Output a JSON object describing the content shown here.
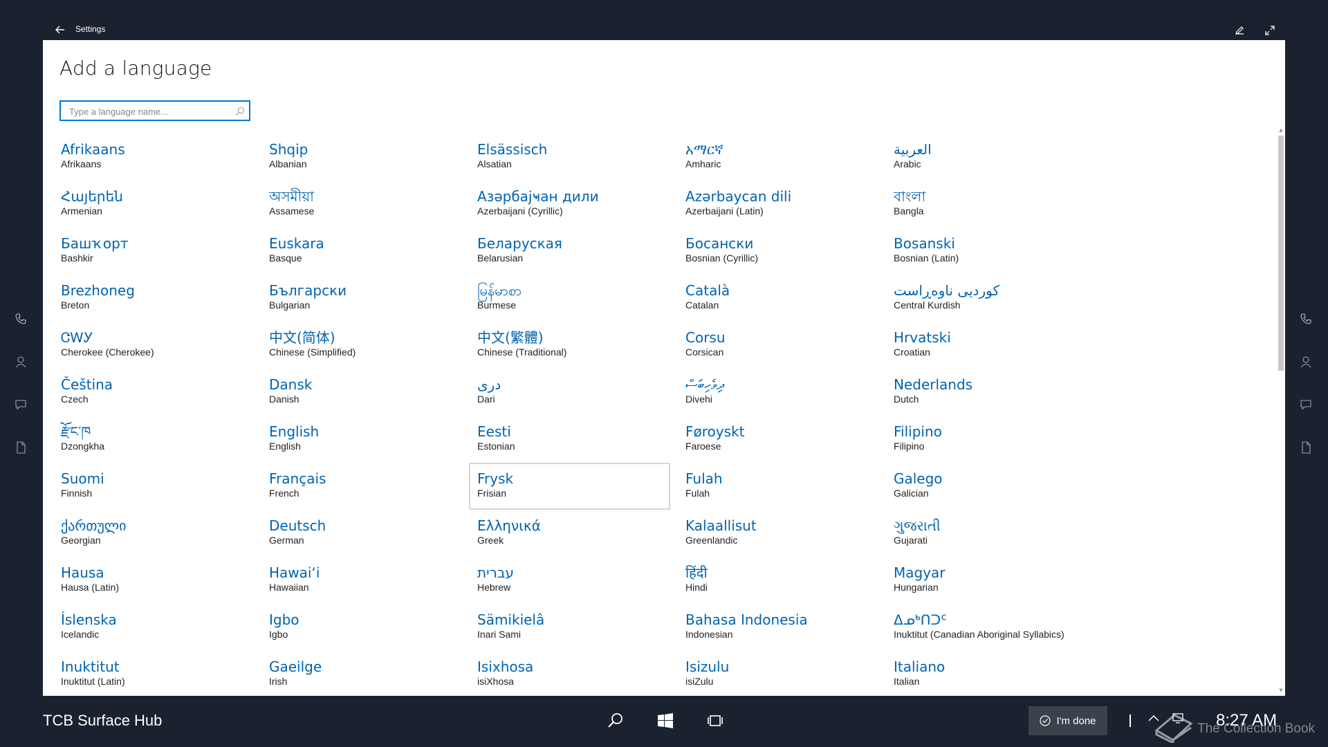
{
  "window": {
    "title": "Settings"
  },
  "page": {
    "title": "Add a language"
  },
  "search": {
    "placeholder": "Type a language name..."
  },
  "languages": [
    {
      "native": "Afrikaans",
      "english": "Afrikaans"
    },
    {
      "native": "Shqip",
      "english": "Albanian"
    },
    {
      "native": "Elsässisch",
      "english": "Alsatian"
    },
    {
      "native": "አማርኛ",
      "english": "Amharic"
    },
    {
      "native": "العربية",
      "english": "Arabic"
    },
    {
      "native": "Հայերեն",
      "english": "Armenian"
    },
    {
      "native": "অসমীয়া",
      "english": "Assamese"
    },
    {
      "native": "Азәрбајҹан дили",
      "english": "Azerbaijani (Cyrillic)"
    },
    {
      "native": "Azərbaycan dili",
      "english": "Azerbaijani (Latin)"
    },
    {
      "native": "বাংলা",
      "english": "Bangla"
    },
    {
      "native": "Башҡорт",
      "english": "Bashkir"
    },
    {
      "native": "Euskara",
      "english": "Basque"
    },
    {
      "native": "Беларуская",
      "english": "Belarusian"
    },
    {
      "native": "Босански",
      "english": "Bosnian (Cyrillic)"
    },
    {
      "native": "Bosanski",
      "english": "Bosnian (Latin)"
    },
    {
      "native": "Brezhoneg",
      "english": "Breton"
    },
    {
      "native": "Български",
      "english": "Bulgarian"
    },
    {
      "native": "မြန်မာစာ",
      "english": "Burmese"
    },
    {
      "native": "Català",
      "english": "Catalan"
    },
    {
      "native": "کوردیی ناوەڕاست",
      "english": "Central Kurdish"
    },
    {
      "native": "ᏣᎳᎩ",
      "english": "Cherokee (Cherokee)"
    },
    {
      "native": "中文(简体)",
      "english": "Chinese (Simplified)"
    },
    {
      "native": "中文(繁體)",
      "english": "Chinese (Traditional)"
    },
    {
      "native": "Corsu",
      "english": "Corsican"
    },
    {
      "native": "Hrvatski",
      "english": "Croatian"
    },
    {
      "native": "Čeština",
      "english": "Czech"
    },
    {
      "native": "Dansk",
      "english": "Danish"
    },
    {
      "native": "درى",
      "english": "Dari"
    },
    {
      "native": "ދިވެހިބަސް",
      "english": "Divehi"
    },
    {
      "native": "Nederlands",
      "english": "Dutch"
    },
    {
      "native": "རྫོང་ཁ",
      "english": "Dzongkha"
    },
    {
      "native": "English",
      "english": "English"
    },
    {
      "native": "Eesti",
      "english": "Estonian"
    },
    {
      "native": "Føroyskt",
      "english": "Faroese"
    },
    {
      "native": "Filipino",
      "english": "Filipino"
    },
    {
      "native": "Suomi",
      "english": "Finnish"
    },
    {
      "native": "Français",
      "english": "French"
    },
    {
      "native": "Frysk",
      "english": "Frisian",
      "selected": true
    },
    {
      "native": "Fulah",
      "english": "Fulah"
    },
    {
      "native": "Galego",
      "english": "Galician"
    },
    {
      "native": "ქართული",
      "english": "Georgian"
    },
    {
      "native": "Deutsch",
      "english": "German"
    },
    {
      "native": "Ελληνικά",
      "english": "Greek"
    },
    {
      "native": "Kalaallisut",
      "english": "Greenlandic"
    },
    {
      "native": "ગુજરાતી",
      "english": "Gujarati"
    },
    {
      "native": "Hausa",
      "english": "Hausa (Latin)"
    },
    {
      "native": "Hawaiʻi",
      "english": "Hawaiian"
    },
    {
      "native": "עברית",
      "english": "Hebrew"
    },
    {
      "native": "हिंदी",
      "english": "Hindi"
    },
    {
      "native": "Magyar",
      "english": "Hungarian"
    },
    {
      "native": "Íslenska",
      "english": "Icelandic"
    },
    {
      "native": "Igbo",
      "english": "Igbo"
    },
    {
      "native": "Sämikielâ",
      "english": "Inari Sami"
    },
    {
      "native": "Bahasa Indonesia",
      "english": "Indonesian"
    },
    {
      "native": "ᐃᓄᒃᑎᑐᑦ",
      "english": "Inuktitut (Canadian Aboriginal Syllabics)"
    },
    {
      "native": "Inuktitut",
      "english": "Inuktitut (Latin)"
    },
    {
      "native": "Gaeilge",
      "english": "Irish"
    },
    {
      "native": "Isixhosa",
      "english": "isiXhosa"
    },
    {
      "native": "Isizulu",
      "english": "isiZulu"
    },
    {
      "native": "Italiano",
      "english": "Italian"
    }
  ],
  "taskbar": {
    "device_name": "TCB Surface Hub",
    "done_label": "I'm done",
    "clock": "8:27 AM"
  },
  "watermark": {
    "text": "The Collection Book"
  },
  "colors": {
    "accent": "#0078d7",
    "link": "#0063b1",
    "background": "#1a2230"
  },
  "icons": {
    "titlebar": [
      "back-arrow-icon",
      "pen-icon",
      "expand-icon"
    ],
    "rails": [
      "phone-icon",
      "person-icon",
      "chat-icon",
      "document-icon"
    ],
    "taskbar": [
      "search-icon",
      "windows-icon",
      "task-view-icon",
      "checkmark-circle-icon",
      "chevron-up-icon",
      "network-icon"
    ]
  }
}
